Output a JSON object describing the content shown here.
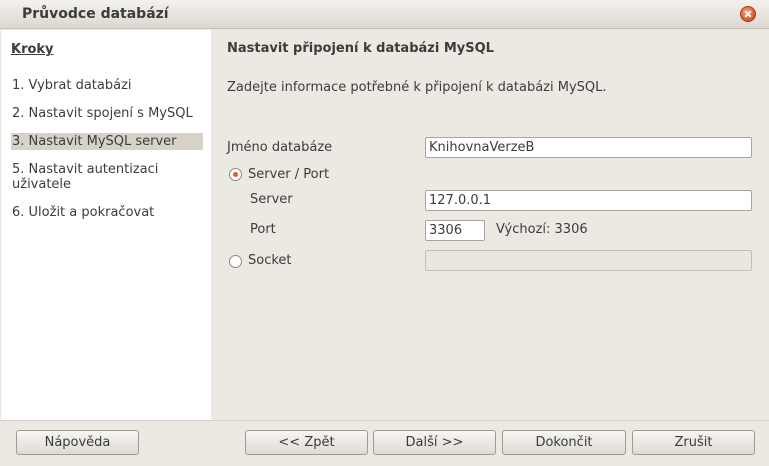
{
  "window": {
    "title": "Průvodce databází"
  },
  "sidebar": {
    "heading": "Kroky",
    "steps": [
      {
        "label": "1. Vybrat databázi"
      },
      {
        "label": "2. Nastavit spojení s MySQL"
      },
      {
        "label": "3. Nastavit MySQL server"
      },
      {
        "label": "5. Nastavit autentizaci uživatele"
      },
      {
        "label": "6. Uložit a pokračovat"
      }
    ],
    "active_step": 2
  },
  "main": {
    "heading": "Nastavit připojení k databázi MySQL",
    "description": "Zadejte informace potřebné k připojení k databázi MySQL.",
    "database_name": {
      "label": "Jméno databáze",
      "value": "KnihovnaVerzeB"
    },
    "server_port_option": {
      "label": "Server / Port",
      "checked": true
    },
    "server": {
      "label": "Server",
      "value": "127.0.0.1"
    },
    "port": {
      "label": "Port",
      "value": "3306",
      "default_text": "Výchozí: 3306"
    },
    "socket_option": {
      "label": "Socket",
      "checked": false,
      "value": ""
    }
  },
  "buttons": {
    "help": "Nápověda",
    "back": "<< Zpět",
    "next": "Další >>",
    "finish": "Dokončit",
    "cancel": "Zrušit"
  },
  "colors": {
    "accent": "#e05a2a",
    "active_step_bg": "#d6d2c8",
    "window_bg": "#ece9e3"
  }
}
